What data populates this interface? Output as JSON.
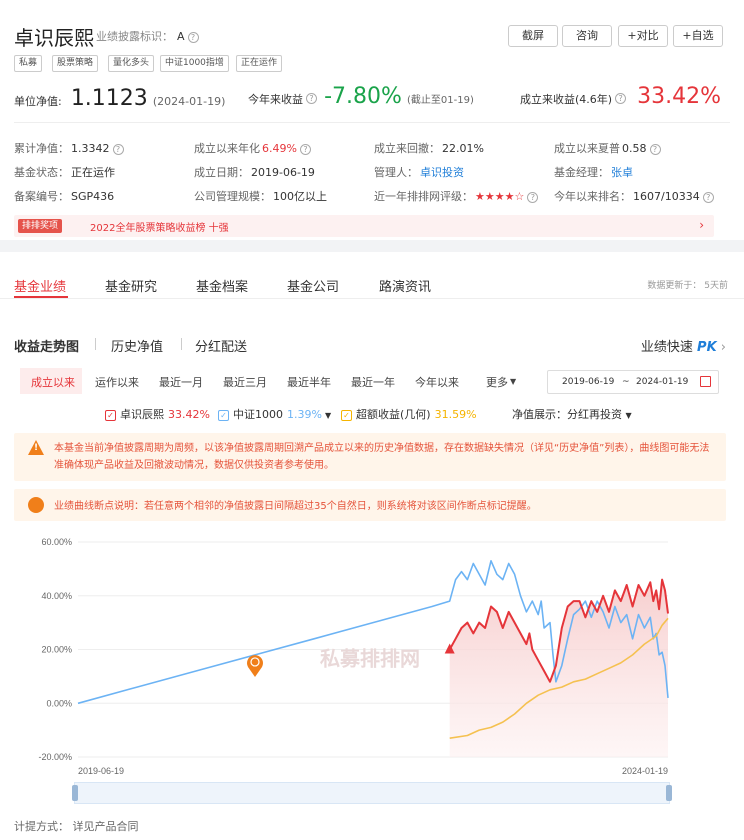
{
  "header": {
    "fund_name": "卓识辰熙",
    "disclosure_label": "业绩披露标识：",
    "disclosure_value": "A",
    "tags": [
      "私募",
      "股票策略",
      "量化多头",
      "中证1000指增",
      "正在运作"
    ],
    "buttons": [
      "截屏",
      "咨询",
      "+对比",
      "+自选"
    ]
  },
  "summary": {
    "nav_label": "单位净值:",
    "nav_value": "1.1123",
    "nav_date": "(2024-01-19)",
    "ytd_label": "今年来收益",
    "ytd_value": "-7.80%",
    "ytd_note": "(截止至01-19)",
    "since_label": "成立来收益(4.6年)",
    "since_value": "33.42%"
  },
  "details": [
    [
      {
        "label": "累计净值：",
        "value": "1.3342",
        "help": true
      },
      {
        "label": "成立以来年化",
        "value": "6.49%",
        "help": true,
        "color": "red"
      },
      {
        "label": "成立来回撤：",
        "value": "22.01%"
      },
      {
        "label": "成立以来夏普",
        "value": "0.58",
        "help": true
      }
    ],
    [
      {
        "label": "基金状态：",
        "value": "正在运作"
      },
      {
        "label": "成立日期：",
        "value": "2019-06-19"
      },
      {
        "label": "管理人：",
        "value": "卓识投资",
        "color": "blue"
      },
      {
        "label": "基金经理：",
        "value": "张卓",
        "color": "blue"
      }
    ],
    [
      {
        "label": "备案编号：",
        "value": "SGP436"
      },
      {
        "label": "公司管理规模：",
        "value": "100亿以上"
      },
      {
        "label": "近一年排排网评级：",
        "value": "★★★★☆",
        "help": true,
        "color": "red"
      },
      {
        "label": "今年以来排名：",
        "value": "1607/10334",
        "help": true
      }
    ]
  ],
  "award": {
    "badge": "排排奖项",
    "text": "2022全年股票策略收益榜 十强"
  },
  "main_tabs": [
    "基金业绩",
    "基金研究",
    "基金档案",
    "基金公司",
    "路演资讯"
  ],
  "update_note": "数据更新于：  5天前",
  "sub_tabs": [
    "收益走势图",
    "历史净值",
    "分红配送"
  ],
  "quick_label": "业绩快速",
  "quick_pk": "PK",
  "ranges": [
    "成立以来",
    "运作以来",
    "最近一月",
    "最近三月",
    "最近半年",
    "最近一年",
    "今年以来",
    "更多"
  ],
  "date_range": {
    "start": "2019-06-19",
    "sep": "~",
    "end": "2024-01-19"
  },
  "legend": [
    {
      "name": "卓识辰熙",
      "value": "33.42%",
      "color": "#e5353a",
      "checked": true
    },
    {
      "name": "中证1000",
      "value": "1.39%",
      "color": "#6cb3f4",
      "checked": true,
      "dropdown": true
    },
    {
      "name": "超额收益(几何)",
      "value": "31.59%",
      "color": "#f5b400",
      "checked": true
    }
  ],
  "nav_display": {
    "label": "净值展示：",
    "value": "分红再投资"
  },
  "notice1": "本基金当前净值披露周期为周频，以该净值披露周期回溯产品成立以来的历史净值数据，存在数据缺失情况（详见“历史净值”列表），曲线图可能无法准确体现产品收益及回撤波动情况，数据仅供投资者参考使用。",
  "notice2": "业绩曲线断点说明：若任意两个相邻的净值披露日间隔超过35个自然日，则系统将对该区间作断点标记提醒。",
  "watermark": "私募排排网",
  "footer": "计提方式：  详见产品合同",
  "chart_data": {
    "type": "line",
    "x_start": "2019-06-19",
    "x_end": "2024-01-19",
    "yticks": [
      "60.00%",
      "40.00%",
      "20.00%",
      "0.00%",
      "-20.00%"
    ],
    "ylim": [
      -20,
      60
    ],
    "x_tick_labels": [
      "2019-06-19",
      "2024-01-19"
    ],
    "series": [
      {
        "name": "中证1000",
        "color": "#6cb3f4",
        "points": [
          [
            0,
            0
          ],
          [
            0.1,
            6
          ],
          [
            0.2,
            12
          ],
          [
            0.3,
            18
          ],
          [
            0.4,
            24
          ],
          [
            0.5,
            30
          ],
          [
            0.6,
            36
          ],
          [
            0.63,
            38
          ],
          [
            0.64,
            46
          ],
          [
            0.65,
            49
          ],
          [
            0.66,
            46
          ],
          [
            0.67,
            52
          ],
          [
            0.68,
            48
          ],
          [
            0.69,
            44
          ],
          [
            0.7,
            53
          ],
          [
            0.71,
            48
          ],
          [
            0.72,
            46
          ],
          [
            0.73,
            52
          ],
          [
            0.74,
            48
          ],
          [
            0.75,
            40
          ],
          [
            0.76,
            34
          ],
          [
            0.77,
            38
          ],
          [
            0.78,
            33
          ],
          [
            0.785,
            38
          ],
          [
            0.79,
            28
          ],
          [
            0.8,
            30
          ],
          [
            0.805,
            18
          ],
          [
            0.81,
            8
          ],
          [
            0.82,
            14
          ],
          [
            0.83,
            24
          ],
          [
            0.84,
            33
          ],
          [
            0.85,
            35
          ],
          [
            0.86,
            38
          ],
          [
            0.87,
            32
          ],
          [
            0.88,
            38
          ],
          [
            0.89,
            34
          ],
          [
            0.9,
            28
          ],
          [
            0.91,
            36
          ],
          [
            0.92,
            30
          ],
          [
            0.93,
            33
          ],
          [
            0.94,
            24
          ],
          [
            0.95,
            33
          ],
          [
            0.96,
            28
          ],
          [
            0.97,
            32
          ],
          [
            0.975,
            24
          ],
          [
            0.98,
            26
          ],
          [
            0.985,
            18
          ],
          [
            0.99,
            19
          ],
          [
            0.995,
            14
          ],
          [
            1.0,
            2
          ]
        ]
      },
      {
        "name": "卓识辰熙",
        "color": "#e5353a",
        "points": [
          [
            0.63,
            20
          ],
          [
            0.64,
            24
          ],
          [
            0.65,
            28
          ],
          [
            0.66,
            30
          ],
          [
            0.67,
            26
          ],
          [
            0.68,
            30
          ],
          [
            0.69,
            28
          ],
          [
            0.7,
            36
          ],
          [
            0.71,
            34
          ],
          [
            0.72,
            28
          ],
          [
            0.73,
            34
          ],
          [
            0.74,
            30
          ],
          [
            0.75,
            26
          ],
          [
            0.76,
            22
          ],
          [
            0.765,
            26
          ],
          [
            0.77,
            20
          ],
          [
            0.78,
            16
          ],
          [
            0.79,
            12
          ],
          [
            0.8,
            8
          ],
          [
            0.81,
            14
          ],
          [
            0.82,
            28
          ],
          [
            0.83,
            36
          ],
          [
            0.84,
            38
          ],
          [
            0.85,
            38
          ],
          [
            0.86,
            32
          ],
          [
            0.87,
            38
          ],
          [
            0.88,
            34
          ],
          [
            0.89,
            40
          ],
          [
            0.9,
            34
          ],
          [
            0.91,
            42
          ],
          [
            0.92,
            38
          ],
          [
            0.93,
            44
          ],
          [
            0.94,
            36
          ],
          [
            0.95,
            44
          ],
          [
            0.96,
            40
          ],
          [
            0.97,
            45
          ],
          [
            0.975,
            38
          ],
          [
            0.98,
            42
          ],
          [
            0.985,
            35
          ],
          [
            0.99,
            46
          ],
          [
            0.995,
            42
          ],
          [
            1.0,
            33.4
          ]
        ]
      },
      {
        "name": "超额收益(几何)",
        "color": "#f5c150",
        "points": [
          [
            0.63,
            -13
          ],
          [
            0.66,
            -12
          ],
          [
            0.68,
            -10
          ],
          [
            0.7,
            -9
          ],
          [
            0.72,
            -7
          ],
          [
            0.74,
            -4
          ],
          [
            0.76,
            0
          ],
          [
            0.78,
            3
          ],
          [
            0.8,
            5
          ],
          [
            0.82,
            6
          ],
          [
            0.84,
            8
          ],
          [
            0.86,
            9
          ],
          [
            0.88,
            11
          ],
          [
            0.9,
            13
          ],
          [
            0.92,
            15
          ],
          [
            0.94,
            18
          ],
          [
            0.96,
            22
          ],
          [
            0.98,
            25
          ],
          [
            0.99,
            29
          ],
          [
            1.0,
            31.6
          ]
        ]
      }
    ],
    "breakpoints": [
      {
        "series": "中证1000",
        "x": 0.3,
        "y": 15
      }
    ],
    "start_marker": {
      "x": 0.63,
      "y": 20
    }
  }
}
